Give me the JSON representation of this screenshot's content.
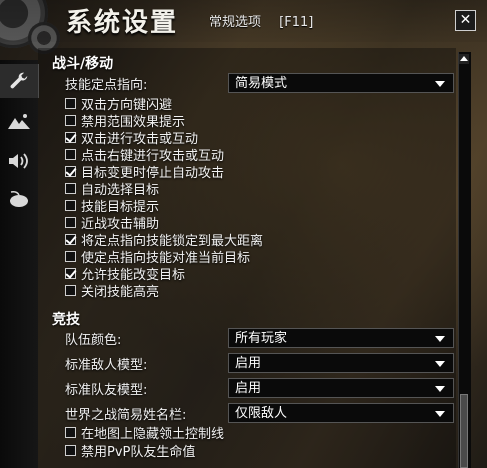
{
  "window": {
    "title": "系统设置",
    "tab_label": "常规选项",
    "hotkey": "[F11]",
    "close_label": "✕"
  },
  "sidebar": {
    "tabs": [
      {
        "icon": "wrench-icon",
        "active": true
      },
      {
        "icon": "landscape-icon",
        "active": false
      },
      {
        "icon": "speaker-icon",
        "active": false
      },
      {
        "icon": "mouse-icon",
        "active": false
      }
    ]
  },
  "combat": {
    "header": "战斗/移动",
    "targeting_label": "技能定点指向:",
    "targeting_value": "简易模式",
    "options": [
      {
        "label": "双击方向键闪避",
        "checked": false
      },
      {
        "label": "禁用范围效果提示",
        "checked": false
      },
      {
        "label": "双击进行攻击或互动",
        "checked": true
      },
      {
        "label": "点击右键进行攻击或互动",
        "checked": false
      },
      {
        "label": "目标变更时停止自动攻击",
        "checked": true
      },
      {
        "label": "自动选择目标",
        "checked": false
      },
      {
        "label": "技能目标提示",
        "checked": false
      },
      {
        "label": "近战攻击辅助",
        "checked": false
      },
      {
        "label": "将定点指向技能锁定到最大距离",
        "checked": true
      },
      {
        "label": "使定点指向技能对准当前目标",
        "checked": false
      },
      {
        "label": "允许技能改变目标",
        "checked": true
      },
      {
        "label": "关闭技能高亮",
        "checked": false
      }
    ]
  },
  "competitive": {
    "header": "竞技",
    "selects": [
      {
        "label": "队伍颜色:",
        "value": "所有玩家"
      },
      {
        "label": "标准敌人模型:",
        "value": "启用"
      },
      {
        "label": "标准队友模型:",
        "value": "启用"
      },
      {
        "label": "世界之战简易姓名栏:",
        "value": "仅限敌人"
      }
    ],
    "options": [
      {
        "label": "在地图上隐藏领土控制线",
        "checked": false
      },
      {
        "label": "禁用PvP队友生命值",
        "checked": false
      }
    ]
  }
}
